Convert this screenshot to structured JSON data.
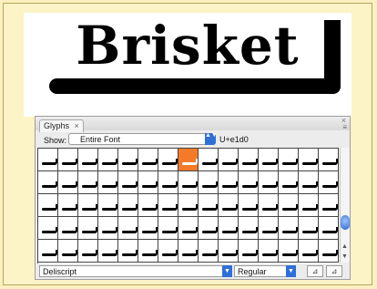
{
  "artwork": {
    "title": "Brisket"
  },
  "panel": {
    "tab_label": "Glyphs",
    "tab_close": "×",
    "close": "×",
    "menu": "≡",
    "show_label": "Show:",
    "show_value": "Entire Font",
    "select_arrows": "▲▼",
    "unicode_readout": "U+e1d0",
    "font_name": "Deliscript",
    "font_style": "Regular",
    "dropdown_arrow": "▼",
    "zoom_out": "⊿",
    "zoom_in": "⊿",
    "scroll_up": "▲",
    "scroll_down": "▼"
  },
  "grid": {
    "columns": 15,
    "rows": 5,
    "selected_row": 0,
    "selected_col": 7,
    "selected_color": "#f47a28"
  }
}
